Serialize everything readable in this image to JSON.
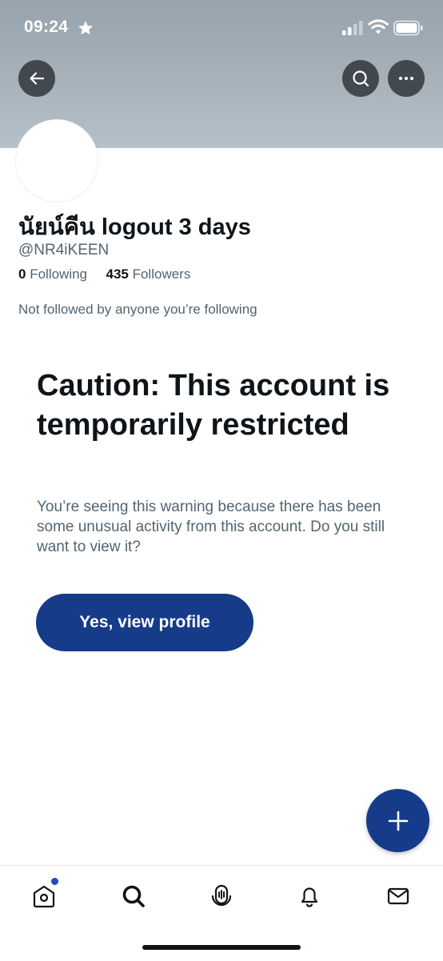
{
  "status_bar": {
    "time": "09:24",
    "icons": [
      "star-icon",
      "signal-icon",
      "wifi-icon",
      "battery-icon"
    ]
  },
  "header": {
    "buttons": [
      "back-arrow-icon",
      "search-icon",
      "more-icon"
    ]
  },
  "profile": {
    "display_name": "นัยน์คีน logout 3 days",
    "handle": "@NR4iKEEN",
    "following_count": "0",
    "following_label": "Following",
    "followers_count": "435",
    "followers_label": "Followers",
    "not_followed_text": "Not followed by anyone you’re following"
  },
  "warning": {
    "title": "Caution: This account is temporarily restricted",
    "body": "You’re seeing this warning because there has been some unusual activity from this account. Do you still want to view it?",
    "button_label": "Yes, view profile"
  },
  "fab": {
    "icon": "plus-icon"
  },
  "tab_bar": {
    "items": [
      "home-icon",
      "explore-icon",
      "spaces-icon",
      "notifications-icon",
      "messages-icon"
    ],
    "home_has_badge": true
  },
  "colors": {
    "primary_button": "#163b89",
    "text_primary": "#0f1419",
    "text_secondary": "#536471",
    "banner": "#a4afb8"
  }
}
